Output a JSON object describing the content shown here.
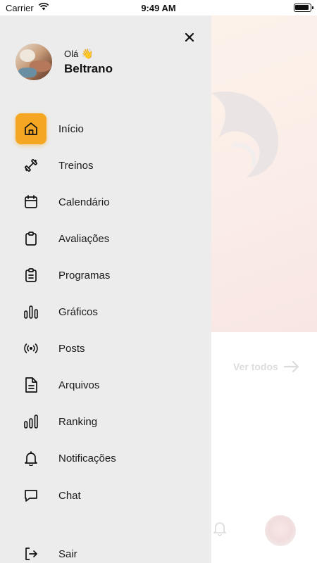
{
  "status_bar": {
    "carrier": "Carrier",
    "time": "9:49 AM"
  },
  "background": {
    "see_all_label": "Ver todos"
  },
  "drawer": {
    "greeting": "Olá",
    "greeting_emoji": "👋",
    "user_name": "Beltrano",
    "menu": [
      {
        "label": "Início",
        "icon": "home-icon",
        "active": true
      },
      {
        "label": "Treinos",
        "icon": "dumbbell-icon"
      },
      {
        "label": "Calendário",
        "icon": "calendar-icon"
      },
      {
        "label": "Avaliações",
        "icon": "clipboard-icon"
      },
      {
        "label": "Programas",
        "icon": "clipboard-list-icon"
      },
      {
        "label": "Gráficos",
        "icon": "bar-chart-icon"
      },
      {
        "label": "Posts",
        "icon": "broadcast-icon"
      },
      {
        "label": "Arquivos",
        "icon": "file-icon"
      },
      {
        "label": "Ranking",
        "icon": "ranking-icon"
      },
      {
        "label": "Notificações",
        "icon": "bell-icon"
      },
      {
        "label": "Chat",
        "icon": "chat-icon"
      }
    ],
    "logout": {
      "label": "Sair",
      "icon": "logout-icon"
    }
  },
  "colors": {
    "accent": "#f5a623",
    "drawer_bg": "#ececec"
  }
}
